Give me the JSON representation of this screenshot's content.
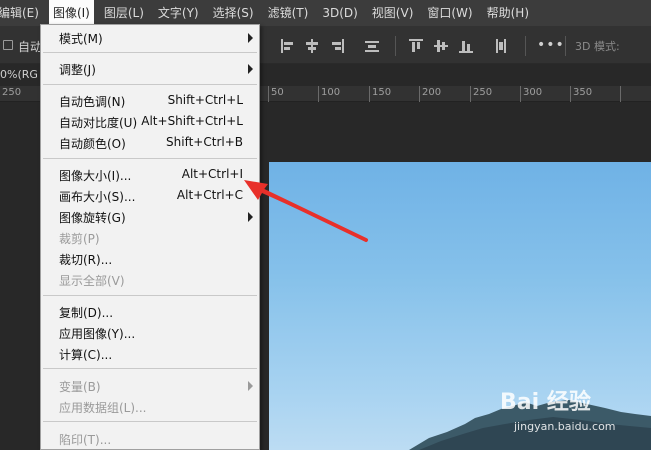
{
  "menubar": {
    "items": [
      "编辑(E)",
      "图像(I)",
      "图层(L)",
      "文字(Y)",
      "选择(S)",
      "滤镜(T)",
      "3D(D)",
      "视图(V)",
      "窗口(W)",
      "帮助(H)"
    ],
    "active_index": 1
  },
  "options": {
    "auto_label": "自动",
    "mode3d_label": "3D 模式:",
    "more": "•••"
  },
  "doc": {
    "tab_text": "0%(RG"
  },
  "ruler": {
    "labels": [
      "50",
      "100",
      "150",
      "200",
      "250",
      "300",
      "350"
    ],
    "left_label": "250"
  },
  "menu": {
    "items": [
      {
        "label": "模式(M)",
        "shortcut": "",
        "submenu": true,
        "disabled": false
      },
      {
        "label": "调整(J)",
        "shortcut": "",
        "submenu": true,
        "disabled": false
      },
      {
        "label": "自动色调(N)",
        "shortcut": "Shift+Ctrl+L",
        "submenu": false,
        "disabled": false
      },
      {
        "label": "自动对比度(U)",
        "shortcut": "Alt+Shift+Ctrl+L",
        "submenu": false,
        "disabled": false
      },
      {
        "label": "自动颜色(O)",
        "shortcut": "Shift+Ctrl+B",
        "submenu": false,
        "disabled": false
      },
      {
        "label": "图像大小(I)...",
        "shortcut": "Alt+Ctrl+I",
        "submenu": false,
        "disabled": false
      },
      {
        "label": "画布大小(S)...",
        "shortcut": "Alt+Ctrl+C",
        "submenu": false,
        "disabled": false
      },
      {
        "label": "图像旋转(G)",
        "shortcut": "",
        "submenu": true,
        "disabled": false
      },
      {
        "label": "裁剪(P)",
        "shortcut": "",
        "submenu": false,
        "disabled": true
      },
      {
        "label": "裁切(R)...",
        "shortcut": "",
        "submenu": false,
        "disabled": false
      },
      {
        "label": "显示全部(V)",
        "shortcut": "",
        "submenu": false,
        "disabled": true
      },
      {
        "label": "复制(D)...",
        "shortcut": "",
        "submenu": false,
        "disabled": false
      },
      {
        "label": "应用图像(Y)...",
        "shortcut": "",
        "submenu": false,
        "disabled": false
      },
      {
        "label": "计算(C)...",
        "shortcut": "",
        "submenu": false,
        "disabled": false
      },
      {
        "label": "变量(B)",
        "shortcut": "",
        "submenu": true,
        "disabled": true
      },
      {
        "label": "应用数据组(L)...",
        "shortcut": "",
        "submenu": false,
        "disabled": true
      },
      {
        "label": "陷印(T)...",
        "shortcut": "",
        "submenu": false,
        "disabled": true
      }
    ]
  },
  "watermark": {
    "brand": "Bai 经验",
    "url": "jingyan.baidu.com"
  },
  "colors": {
    "menubar_bg": "#3c3c3c",
    "menu_bg": "#f2f2f2",
    "arrow_red": "#e8302a",
    "sky": "#86c1ea"
  }
}
